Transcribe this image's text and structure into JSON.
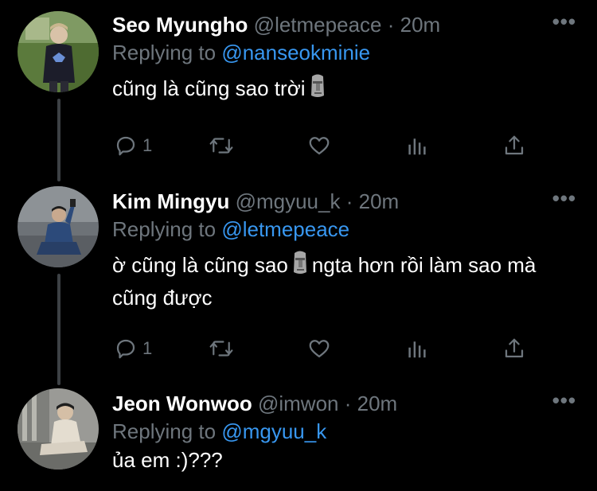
{
  "colors": {
    "background": "#000000",
    "name": "#ffffff",
    "meta": "#6e767d",
    "mention": "#3897f0",
    "thread_line": "#3d4145"
  },
  "tweets": [
    {
      "name": "Seo Myungho",
      "handle": "@letmepeace",
      "separator": "·",
      "time": "20m",
      "replying_prefix": "Replying to",
      "replying_to": "@nanseokminie",
      "text_parts": [
        "cũng là cũng sao trời",
        ""
      ],
      "emoji": "moai-emoji",
      "reply_count": "1",
      "icons": [
        "reply-icon",
        "retweet-icon",
        "like-icon",
        "analytics-icon",
        "share-icon"
      ]
    },
    {
      "name": "Kim Mingyu",
      "handle": "@mgyuu_k",
      "separator": "·",
      "time": "20m",
      "replying_prefix": "Replying to",
      "replying_to": "@letmepeace",
      "text_parts": [
        "ờ cũng là cũng sao",
        "ngta hơn rồi làm sao mà cũng được"
      ],
      "emoji": "moai-emoji",
      "reply_count": "1",
      "icons": [
        "reply-icon",
        "retweet-icon",
        "like-icon",
        "analytics-icon",
        "share-icon"
      ]
    },
    {
      "name": "Jeon Wonwoo",
      "handle": "@imwon",
      "separator": "·",
      "time": "20m",
      "replying_prefix": "Replying to",
      "replying_to": "@mgyuu_k",
      "text": "ủa em :)???"
    }
  ],
  "more_glyph": "•••"
}
